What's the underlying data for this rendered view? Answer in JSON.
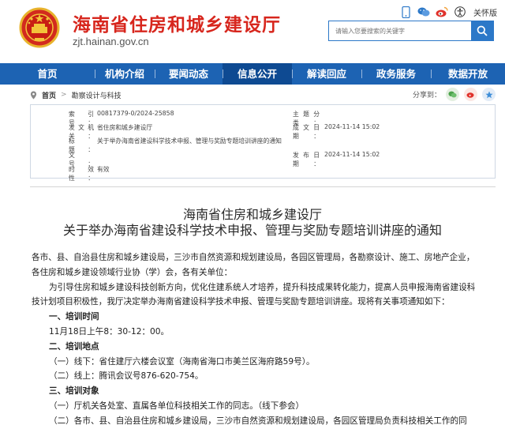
{
  "header": {
    "site_title": "海南省住房和城乡建设厅",
    "site_domain": "zjt.hainan.gov.cn",
    "elder_mode": "关怀版",
    "search_placeholder": "请输入您要搜索的关键字",
    "icons": [
      "mobile-icon",
      "wechat-icon",
      "weibo-icon",
      "accessibility-icon"
    ]
  },
  "nav": {
    "items": [
      "首页",
      "机构介绍",
      "要闻动态",
      "信息公开",
      "解读回应",
      "政务服务",
      "数据开放"
    ],
    "active_index": 3
  },
  "breadcrumb": {
    "items": [
      "首页",
      "勘察设计与科技"
    ],
    "share_label": "分享到："
  },
  "meta": {
    "index_label": "索 引 号：",
    "index_value": "00817379-0/2024-25858",
    "category_label": "主题分类：",
    "category_value": "",
    "publisher_label": "发文机关：",
    "publisher_value": "省住房和城乡建设厅",
    "created_label": "成文日期：",
    "created_value": "2024-11-14 15:02",
    "title_label": "标　　题：",
    "title_value": "关于举办海南省建设科学技术申报、管理与奖励专题培训讲座的通知",
    "docno_label": "文　　号：",
    "docno_value": "",
    "published_label": "发布日期：",
    "published_value": "2024-11-14 15:02",
    "validity_label": "时 效 性：",
    "validity_value": "有效"
  },
  "article": {
    "title_line1": "海南省住房和城乡建设厅",
    "title_line2": "关于举办海南省建设科学技术申报、管理与奖励专题培训讲座的通知",
    "lines": [
      "各市、县、自治县住房和城乡建设局，三沙市自然资源和规划建设局，各园区管理局，各勘察设计、施工、房地产企业，",
      "各住房和城乡建设领域行业协（学）会，各有关单位：",
      "为引导住房和城乡建设科技创新方向，优化住建系统人才培养，提升科技成果转化能力，提高人员申报海南省建设科",
      "技计划项目积极性，我厅决定举办海南省建设科学技术申报、管理与奖励专题培训讲座。现将有关事项通知如下：",
      "一、培训时间",
      "11月18日上午8：30-12：00。",
      "二、培训地点",
      "（一）线下：省住建厅六楼会议室（海南省海口市美兰区海府路59号）。",
      "（二）线上：腾讯会议号876-620-754。",
      "三、培训对象",
      "（一）厅机关各处室、直属各单位科技相关工作的同志。（线下参会）",
      "（二）各市、县、自治县住房和城乡建设局，三沙市自然资源和规划建设局，各园区管理局负责科技相关工作的同"
    ]
  }
}
